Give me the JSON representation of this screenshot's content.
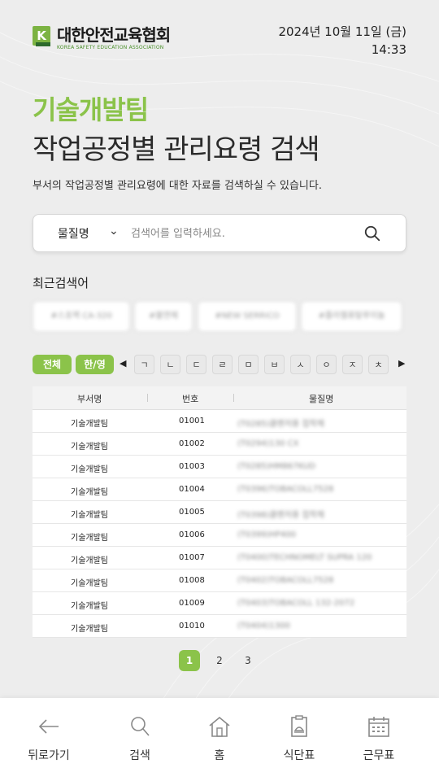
{
  "header": {
    "logo_letter": "K",
    "logo_name": "대한안전교육협회",
    "logo_sub": "KOREA SAFETY EDUCATION ASSOCIATION",
    "date": "2024년 10월 11일 (금)",
    "time": "14:33"
  },
  "team_name": "기술개발팀",
  "page_title": "작업공정별 관리요령 검색",
  "description": "부서의 작업공정별 관리요령에 대한 자료를 검색하실 수 있습니다.",
  "search": {
    "select_value": "물질명",
    "placeholder": "검색어를 입력하세요."
  },
  "recent": {
    "label": "최근검색어",
    "chips": [
      "#스포랙 CA-320",
      "#불연제",
      "#NEW SERRICO",
      "#플라젤퓨탈루이놀"
    ]
  },
  "index_filter": {
    "all_label": "전체",
    "lang_label": "한/영",
    "prev": "◀",
    "next": "▶",
    "consonants": [
      "ㄱ",
      "ㄴ",
      "ㄷ",
      "ㄹ",
      "ㅁ",
      "ㅂ",
      "ㅅ",
      "ㅇ",
      "ㅈ",
      "ㅊ"
    ]
  },
  "table": {
    "headers": [
      "부서명",
      "번호",
      "물질명"
    ],
    "rows": [
      {
        "dept": "기술개발팀",
        "no": "01001",
        "material": "(T0285)클렌저용 접착제"
      },
      {
        "dept": "기술개발팀",
        "no": "01002",
        "material": "(T0294)130 CX"
      },
      {
        "dept": "기술개발팀",
        "no": "01003",
        "material": "(T0285)HM867KUD"
      },
      {
        "dept": "기술개발팀",
        "no": "01004",
        "material": "(T0396)TOBACOLL7528"
      },
      {
        "dept": "기술개발팀",
        "no": "01005",
        "material": "(T0398)클렌저용 접착제"
      },
      {
        "dept": "기술개발팀",
        "no": "01006",
        "material": "(T0399)HP400"
      },
      {
        "dept": "기술개발팀",
        "no": "01007",
        "material": "(T0400)TECHNOMELT SUPRA 120"
      },
      {
        "dept": "기술개발팀",
        "no": "01008",
        "material": "(T0402)TOBACOLL7528"
      },
      {
        "dept": "기술개발팀",
        "no": "01009",
        "material": "(T0403)TOBACOLL 132-2072"
      },
      {
        "dept": "기술개발팀",
        "no": "01010",
        "material": "(T0404)1300"
      }
    ]
  },
  "pagination": {
    "pages": [
      "1",
      "2",
      "3"
    ],
    "current": "1"
  },
  "bottom_nav": [
    {
      "label": "뒤로가기",
      "icon": "back-arrow-icon"
    },
    {
      "label": "검색",
      "icon": "search-icon"
    },
    {
      "label": "홈",
      "icon": "home-icon"
    },
    {
      "label": "식단표",
      "icon": "menu-clipboard-icon"
    },
    {
      "label": "근무표",
      "icon": "calendar-icon"
    }
  ],
  "colors": {
    "accent": "#8bc34a",
    "background": "#ededed"
  }
}
